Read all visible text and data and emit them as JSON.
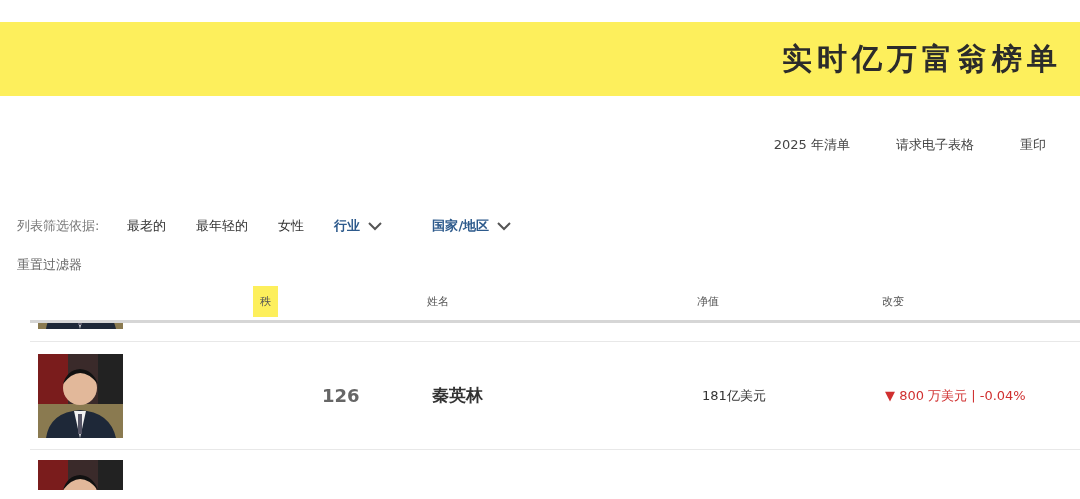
{
  "banner": {
    "title": "实时亿万富翁榜单"
  },
  "links": [
    "2025 年清单",
    "请求电子表格",
    "重印"
  ],
  "filters": {
    "label": "列表筛选依据:",
    "items": [
      {
        "kind": "plain",
        "label": "最老的"
      },
      {
        "kind": "plain",
        "label": "最年轻的"
      },
      {
        "kind": "plain",
        "label": "女性"
      },
      {
        "kind": "dropdown",
        "label": "行业"
      },
      {
        "kind": "dropdown",
        "label": "国家/地区"
      }
    ],
    "reset": "重置过滤器"
  },
  "table": {
    "columns": [
      {
        "label": "秩",
        "selected": true
      },
      {
        "label": "姓名",
        "selected": false
      },
      {
        "label": "净值",
        "selected": false
      },
      {
        "label": "改变",
        "selected": false
      }
    ],
    "rows": [
      {
        "kind": "clipped-top"
      },
      {
        "kind": "full",
        "rank": "126",
        "name": "秦英林",
        "net_worth": "181亿美元",
        "change": {
          "color": "#d03030",
          "arrow": "▼",
          "text": "800 万美元 | -0.04%"
        }
      },
      {
        "kind": "clipped-bottom"
      }
    ]
  }
}
